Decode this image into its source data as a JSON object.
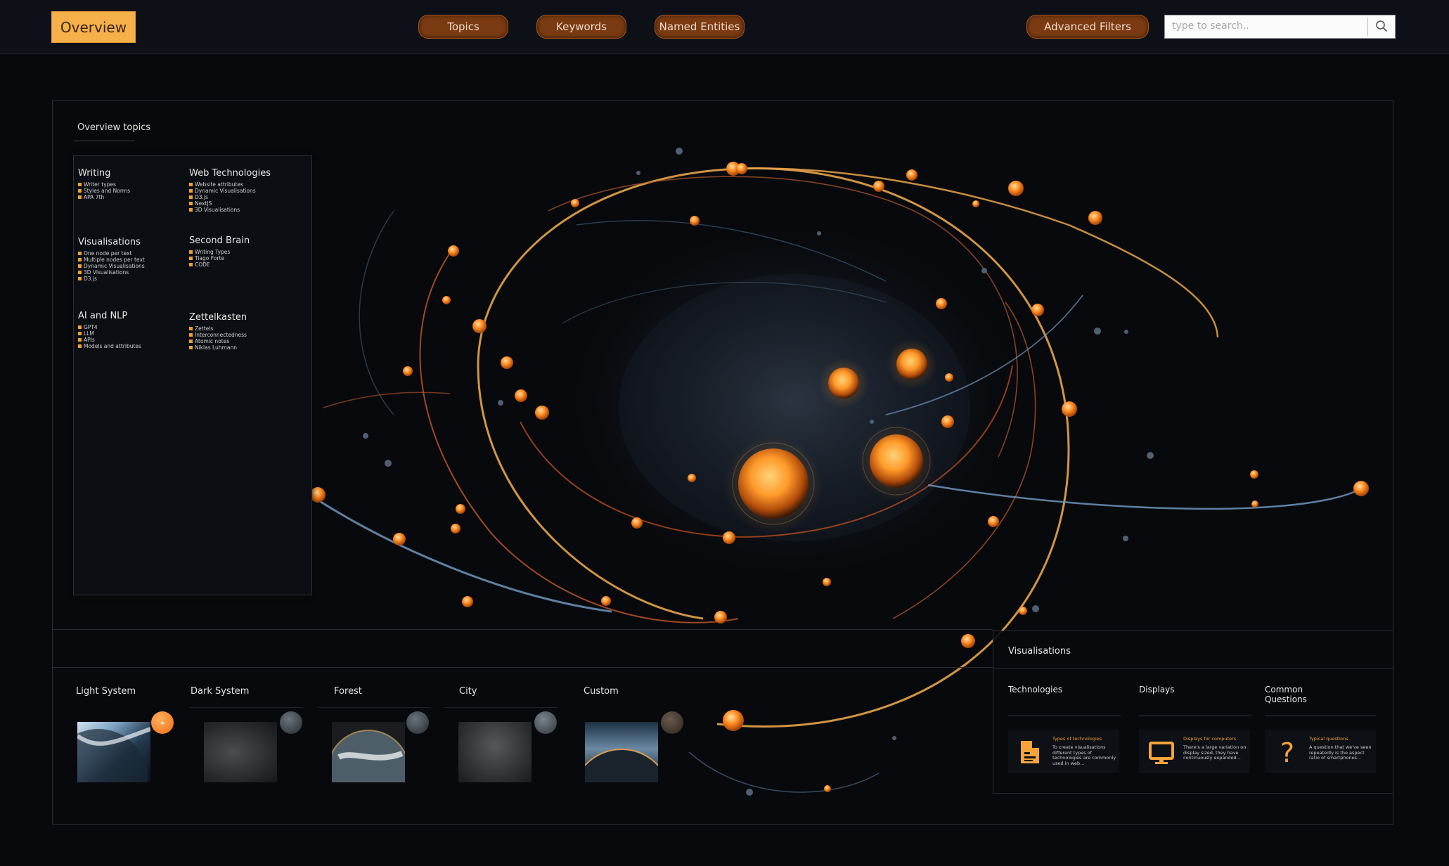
{
  "header": {
    "overview_label": "Overview",
    "nav": [
      {
        "label": "Topics"
      },
      {
        "label": "Keywords"
      },
      {
        "label": "Named Entities"
      }
    ],
    "advanced_filters_label": "Advanced Filters",
    "search_placeholder": "type to search.."
  },
  "sidebar": {
    "title": "Overview topics",
    "categories": [
      {
        "title": "Writing",
        "items": [
          "Writer types",
          "Styles and Norms",
          "APA 7th"
        ]
      },
      {
        "title": "Web Technologies",
        "items": [
          "Website attributes",
          "Dynamic Visualisations",
          "D3.js",
          "NextJS",
          "3D Visualisations"
        ]
      },
      {
        "title": "Visualisations",
        "items": [
          "One node per text",
          "Multiple nodes per text",
          "Dynamic Visualisations",
          "3D Visualisations",
          "D3.js"
        ]
      },
      {
        "title": "Second Brain",
        "items": [
          "Writing Types",
          "Tiago Forte",
          "CODE"
        ]
      },
      {
        "title": "AI and NLP",
        "items": [
          "GPT4",
          "LLM",
          "APIs",
          "Models and attributes"
        ]
      },
      {
        "title": "Zettelkasten",
        "items": [
          "Zettels",
          "Interconnectedness",
          "Atomic notes",
          "Niklas Luhmann"
        ]
      }
    ]
  },
  "themes": [
    {
      "label": "Light System"
    },
    {
      "label": "Dark System"
    },
    {
      "label": "Forest"
    },
    {
      "label": "City"
    },
    {
      "label": "Custom"
    }
  ],
  "visualisations": {
    "title": "Visualisations",
    "columns": [
      {
        "title": "Technologies",
        "card_heading": "Types of technologies",
        "card_text": "To create visualisations different types of technologies are commonly used in web..."
      },
      {
        "title": "Displays",
        "card_heading": "Displays for computers",
        "card_text": "There's a large variation on display sized, they have continuously expanded..."
      },
      {
        "title_line1": "Common",
        "title_line2": "Questions",
        "card_heading": "Typical questions",
        "card_text": "A question that we've seen repeatedly is the aspect ratio of smartphones..."
      }
    ]
  },
  "colors": {
    "accent": "#f5b049",
    "pill": "#7a3a12",
    "node": "#ff8a1e",
    "orbit_blue": "#6f95bd"
  }
}
